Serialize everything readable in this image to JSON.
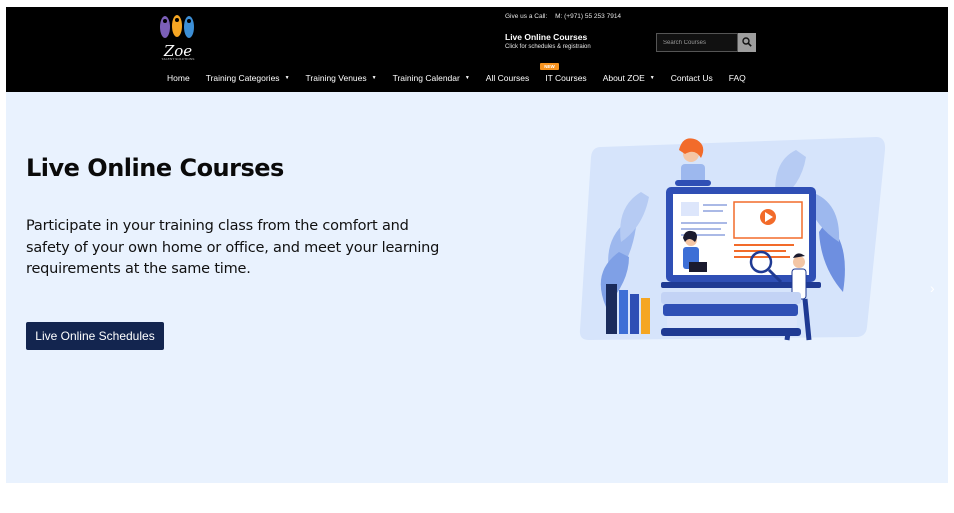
{
  "header": {
    "logo_text": "Zoe",
    "logo_tagline": "TALENT SOLUTIONS",
    "call_label": "Give us a Call:",
    "call_phone": "M: (+971) 55 253 7914",
    "promo_title": "Live Online Courses",
    "promo_subtitle": "Click for schedules & registraion",
    "search_placeholder": "Search Courses"
  },
  "nav": {
    "items": [
      {
        "label": "Home"
      },
      {
        "label": "Training Categories"
      },
      {
        "label": "Training Venues"
      },
      {
        "label": "Training Calendar"
      },
      {
        "label": "All Courses"
      },
      {
        "label": "IT Courses",
        "badge": "NEW"
      },
      {
        "label": "About ZOE"
      },
      {
        "label": "Contact Us"
      },
      {
        "label": "FAQ"
      }
    ]
  },
  "hero": {
    "title": "Live Online Courses",
    "description": "Participate in your training class from the comfort and safety of your own home or office, and meet your learning requirements at the same time.",
    "button_label": "Live Online Schedules",
    "next_arrow": "›"
  },
  "colors": {
    "header_bg": "#000000",
    "hero_bg": "#e9f2fe",
    "button_bg": "#13254f",
    "badge_bg": "#f7931e",
    "illustration_blue": "#2f4fb5",
    "illustration_orange": "#f26b2a"
  },
  "icons": {
    "search": "search-icon",
    "caret": "caret-down-icon",
    "logo": "zoe-logo-icon"
  }
}
